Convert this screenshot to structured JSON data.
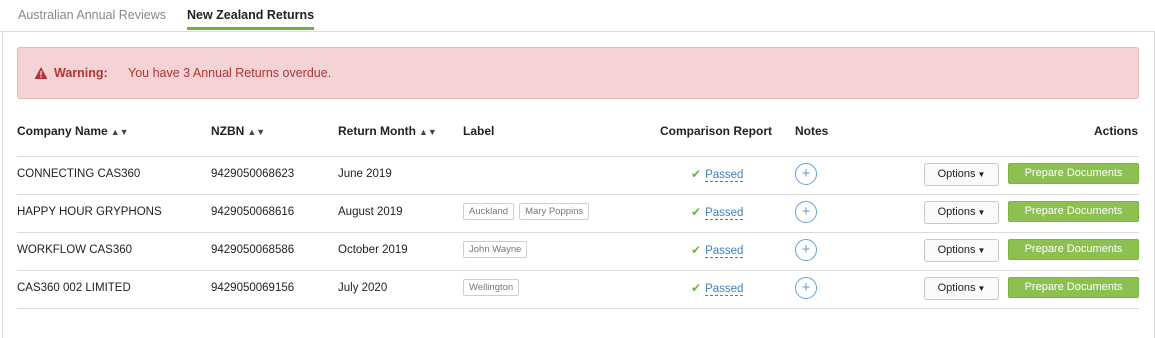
{
  "tabs": [
    {
      "label": "Australian Annual Reviews",
      "active": false
    },
    {
      "label": "New Zealand Returns",
      "active": true
    }
  ],
  "alert": {
    "icon": "warning-triangle-icon",
    "title": "Warning:",
    "message": "You have 3 Annual Returns overdue."
  },
  "table": {
    "headers": {
      "company_name": "Company Name",
      "nzbn": "NZBN",
      "return_month": "Return Month",
      "label": "Label",
      "comparison_report": "Comparison Report",
      "notes": "Notes",
      "actions": "Actions"
    },
    "rows": [
      {
        "company_name": "CONNECTING CAS360",
        "nzbn": "9429050068623",
        "return_month": "June 2019",
        "labels": [],
        "report": "Passed",
        "options": "Options",
        "prepare": "Prepare Documents"
      },
      {
        "company_name": "HAPPY HOUR GRYPHONS",
        "nzbn": "9429050068616",
        "return_month": "August 2019",
        "labels": [
          "Auckland",
          "Mary Poppins"
        ],
        "report": "Passed",
        "options": "Options",
        "prepare": "Prepare Documents"
      },
      {
        "company_name": "WORKFLOW CAS360",
        "nzbn": "9429050068586",
        "return_month": "October 2019",
        "labels": [
          "John Wayne"
        ],
        "report": "Passed",
        "options": "Options",
        "prepare": "Prepare Documents"
      },
      {
        "company_name": "CAS360 002 LIMITED",
        "nzbn": "9429050069156",
        "return_month": "July 2020",
        "labels": [
          "Wellington"
        ],
        "report": "Passed",
        "options": "Options",
        "prepare": "Prepare Documents"
      }
    ]
  },
  "colors": {
    "accent_green": "#8cc152",
    "tab_underline": "#6cb33e",
    "link_blue": "#3f7fc0",
    "alert_bg": "#f3d3d3",
    "alert_text": "#b0353a"
  }
}
